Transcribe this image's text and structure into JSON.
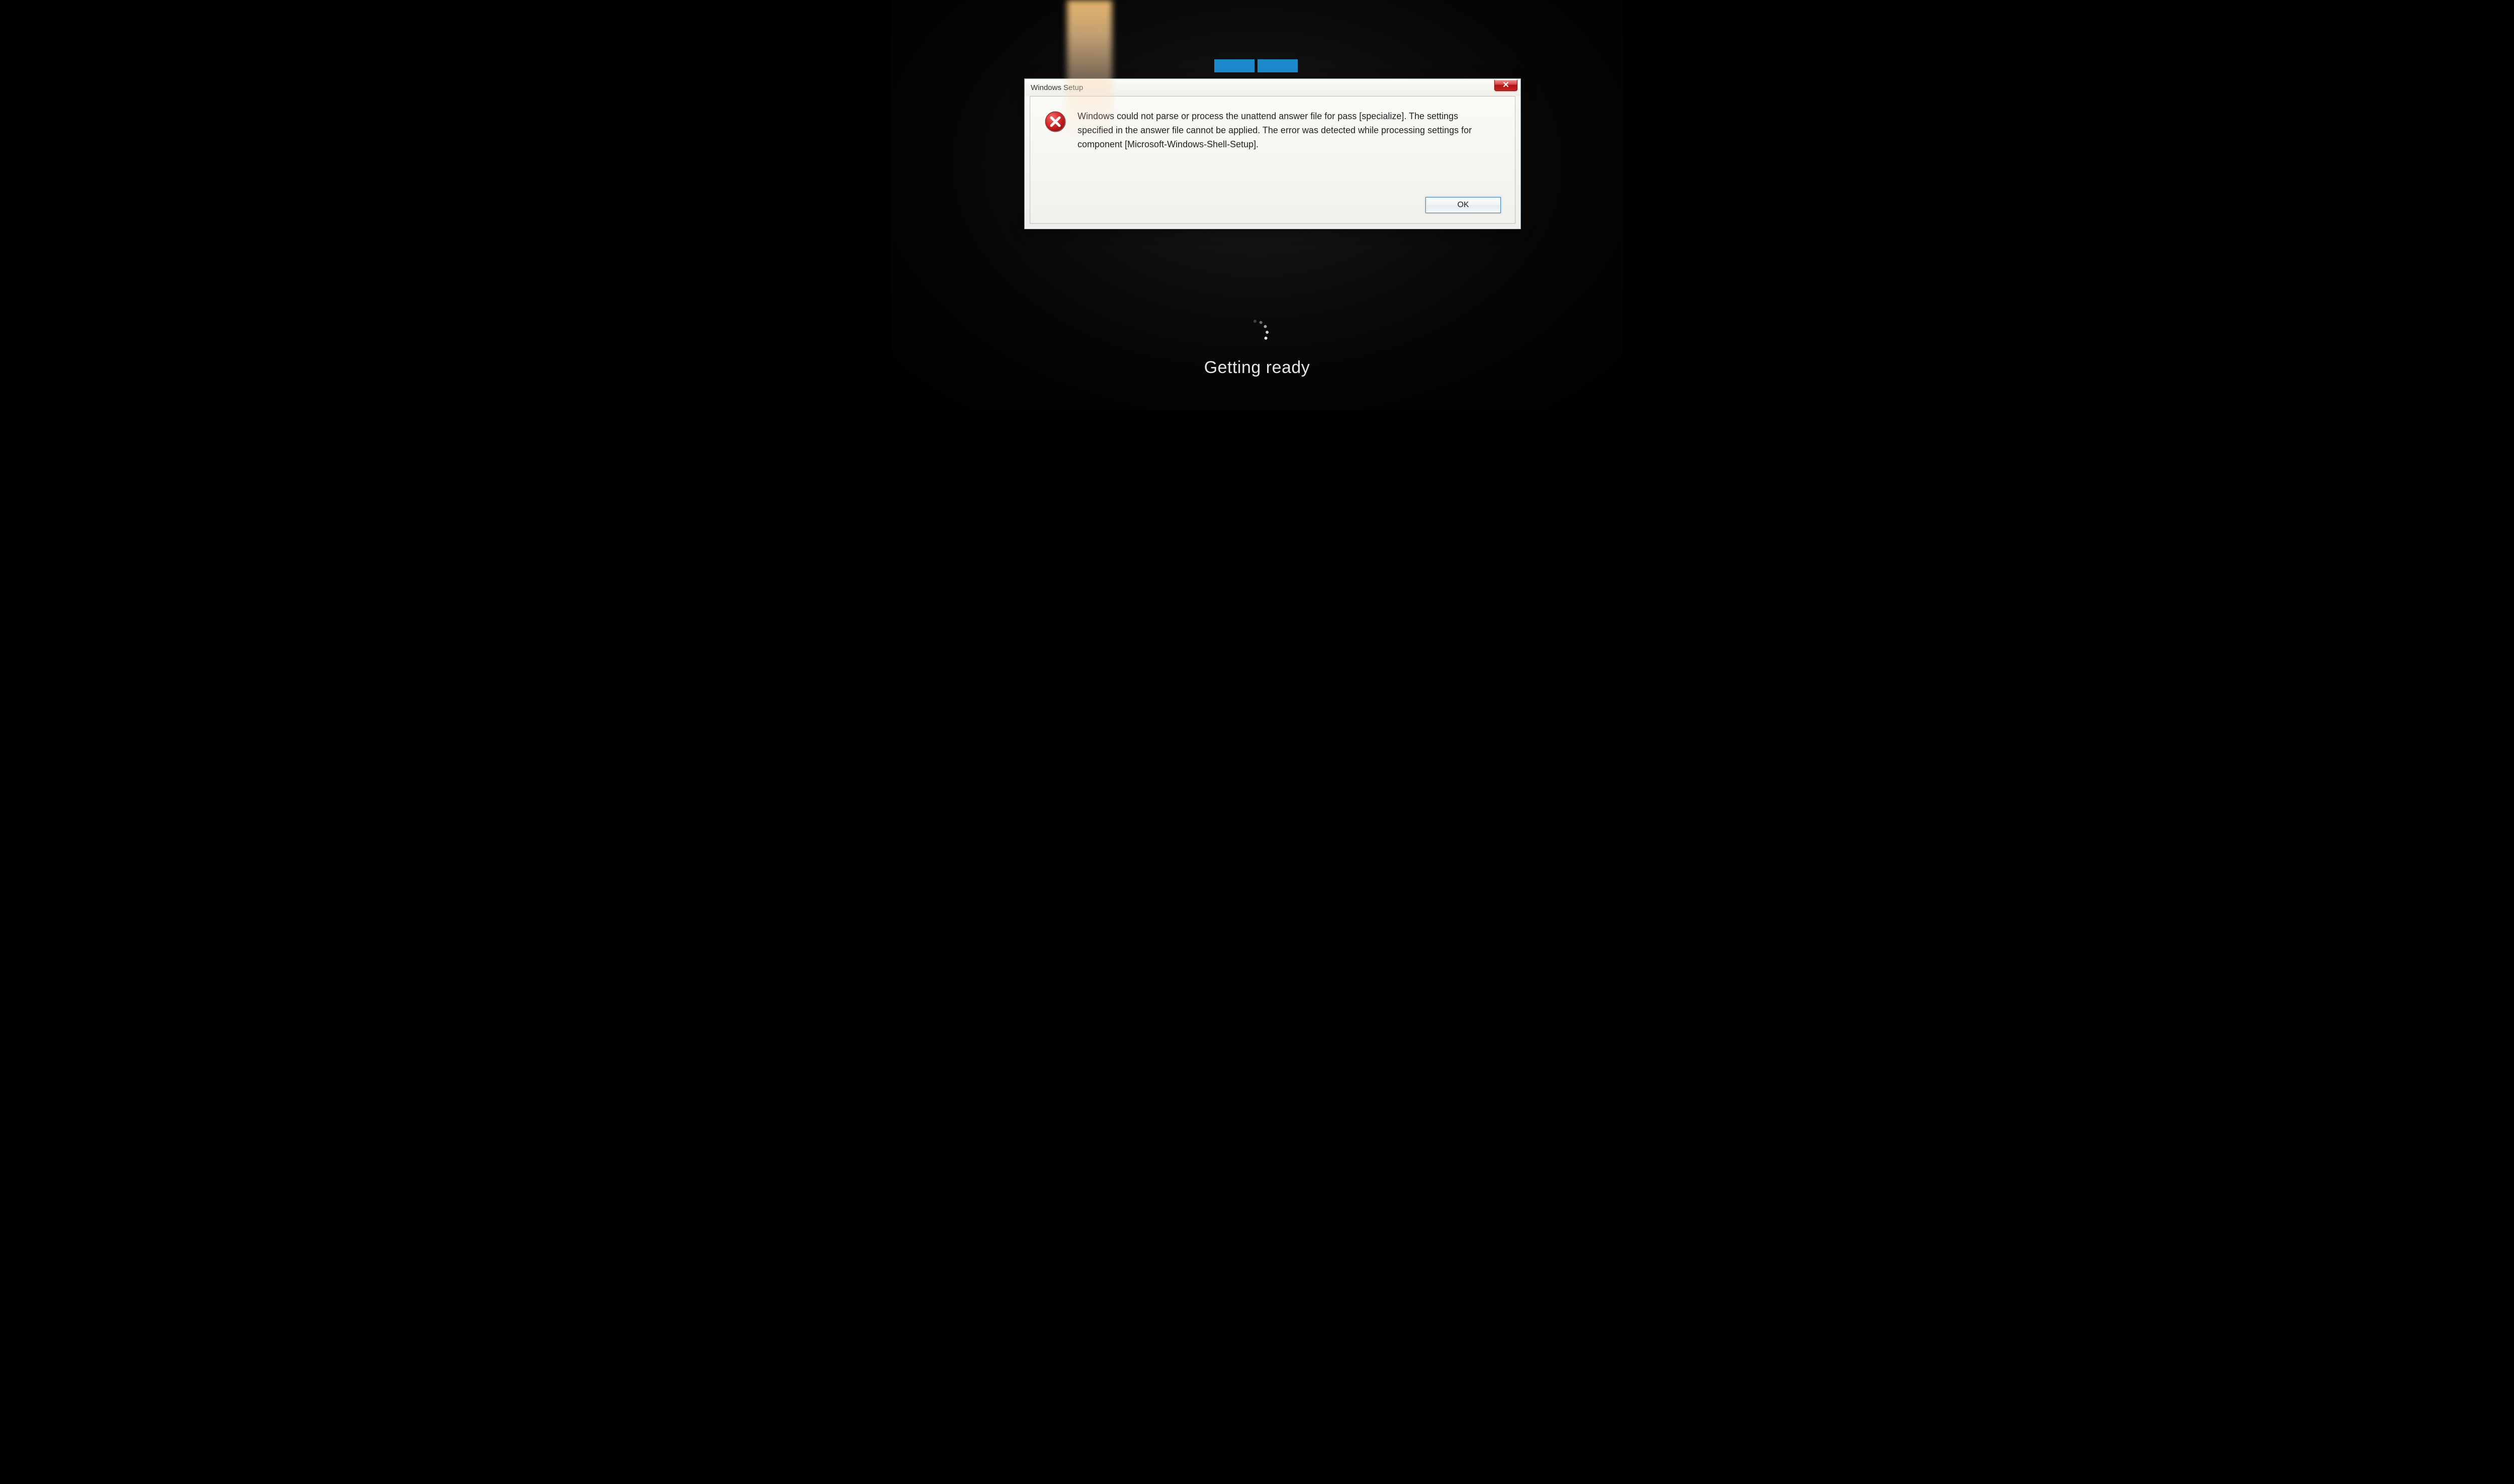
{
  "background": {
    "status_text": "Getting ready",
    "logo": "windows-logo"
  },
  "dialog": {
    "title": "Windows Setup",
    "icon": "error-icon",
    "message": "Windows could not parse or process the unattend answer file for pass [specialize]. The settings specified in the answer file cannot be applied. The error was detected while processing settings for component [Microsoft-Windows-Shell-Setup].",
    "ok_label": "OK",
    "close_label": "Close"
  },
  "colors": {
    "close_button": "#c82020",
    "ok_border": "#3c7fb1",
    "logo_tile": "#1e90d6"
  }
}
